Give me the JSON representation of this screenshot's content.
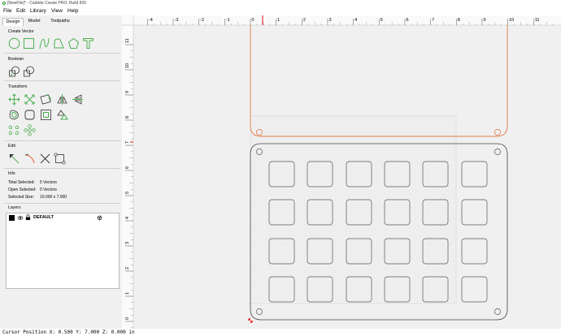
{
  "app": {
    "title": "[NewFile]* - Carbide Create PRO, Build 830"
  },
  "menu": {
    "items": [
      "File",
      "Edit",
      "Library",
      "View",
      "Help"
    ]
  },
  "panel": {
    "tabs": [
      "Design",
      "Model",
      "Toolpaths"
    ],
    "sections": {
      "create_vector": "Create Vector",
      "boolean": "Boolean",
      "transform": "Transform",
      "edit": "Edit",
      "info": "Info",
      "layers": "Layers"
    },
    "info": {
      "total_selected_label": "Total Selected:",
      "total_selected_value": "5 Vectors",
      "open_selected_label": "Open Selected:",
      "open_selected_value": "0 Vectors",
      "selected_size_label": "Selected Size:",
      "selected_size_value": "10.000 x 7.000"
    },
    "layer": {
      "name": "DEFAULT",
      "color": "#000000"
    }
  },
  "ruler": {
    "h_ticks": [
      "-4",
      "-3",
      "-2",
      "-1",
      "0",
      "1",
      "2",
      "3",
      "4",
      "5",
      "6",
      "7",
      "8",
      "9",
      "10",
      "11"
    ],
    "v_ticks": [
      "11",
      "10",
      "9",
      "8",
      "7",
      "6",
      "5",
      "4",
      "3",
      "2",
      "1",
      "0"
    ]
  },
  "status": {
    "cursor_position": "Cursor Position X: 0.500 Y: 7.000 Z: 0.000 in"
  },
  "colors": {
    "accent_green": "#4caf50",
    "selection_orange": "#e07a4a",
    "cursor_red": "#e53935"
  }
}
